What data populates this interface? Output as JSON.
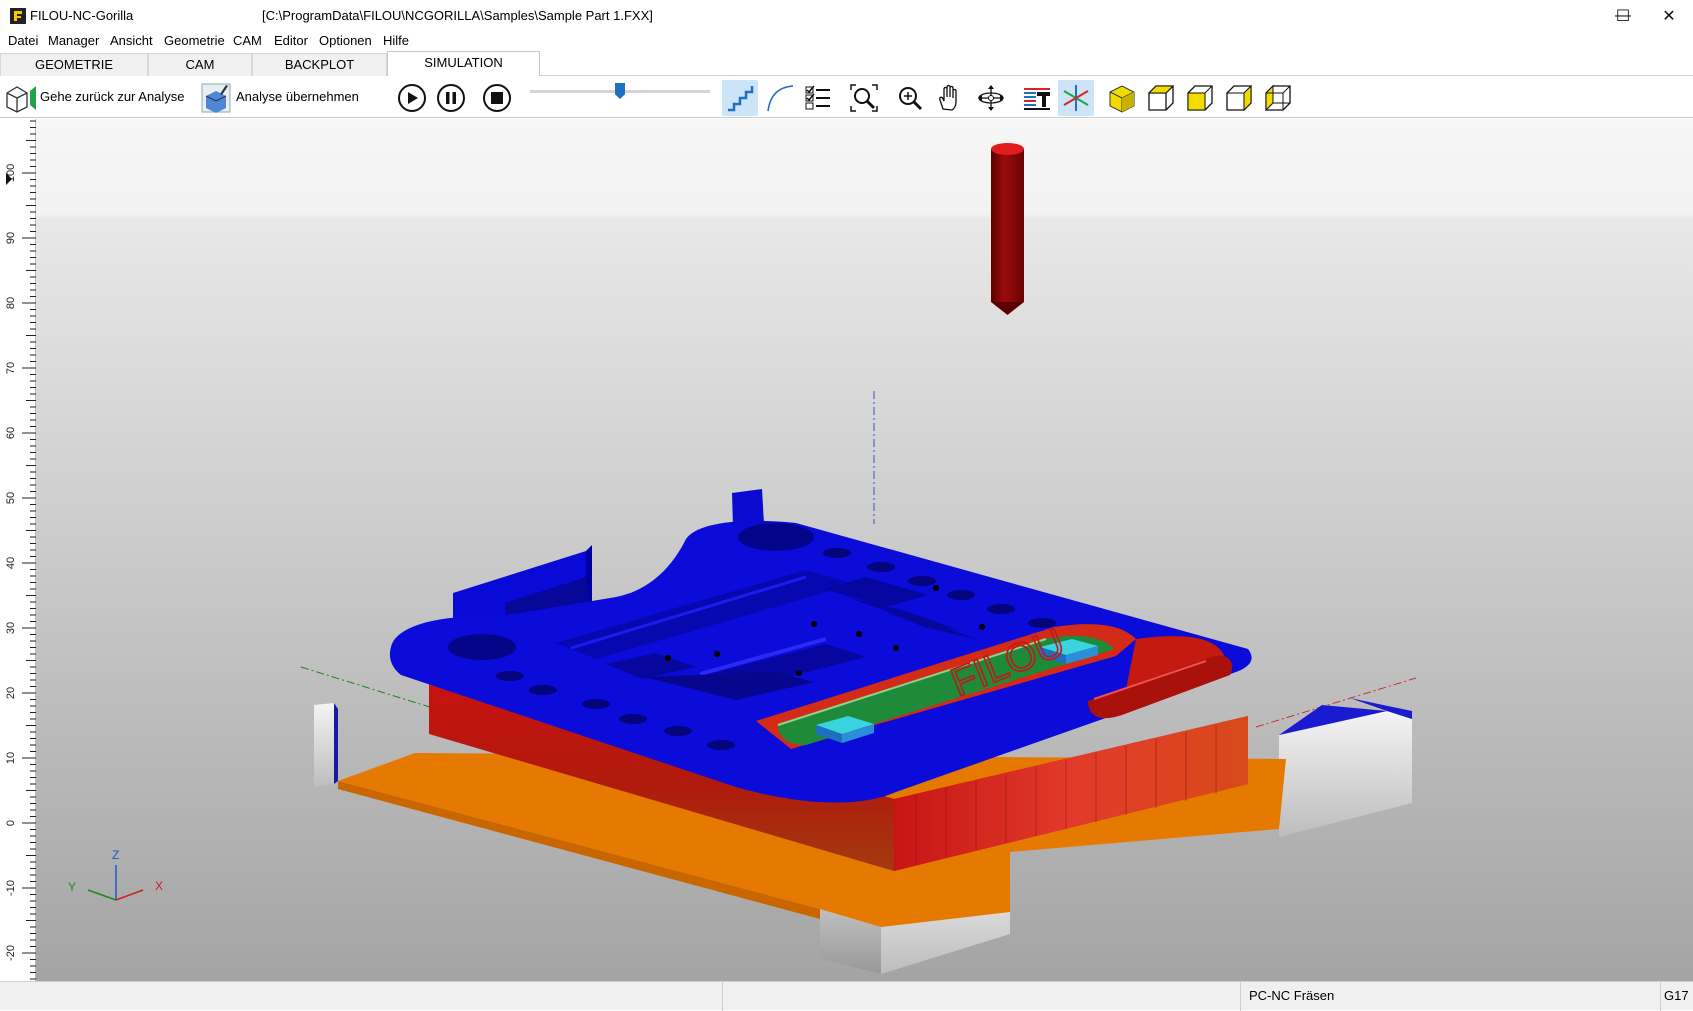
{
  "window": {
    "app_name": "FILOU-NC-Gorilla",
    "document_path": "[C:\\ProgramData\\FILOU\\NCGORILLA\\Samples\\Sample Part 1.FXX]",
    "minimize": "—",
    "maximize": "☐",
    "close": "✕"
  },
  "menu": [
    "Datei",
    "Manager",
    "Ansicht",
    "Geometrie",
    "CAM",
    "Editor",
    "Optionen",
    "Hilfe"
  ],
  "tabs": [
    {
      "label": "GEOMETRIE",
      "active": false
    },
    {
      "label": "CAM",
      "active": false
    },
    {
      "label": "BACKPLOT",
      "active": false
    },
    {
      "label": "SIMULATION",
      "active": true
    }
  ],
  "toolbar": {
    "back_label": "Gehe zurück zur Analyse",
    "apply_label": "Analyse übernehmen",
    "speed_fraction": 0.5
  },
  "ruler": {
    "labels": [
      "100",
      "90",
      "80",
      "70",
      "60",
      "50",
      "40",
      "30",
      "20",
      "10",
      "0",
      "-10",
      "-20"
    ]
  },
  "axes": {
    "z": "Z",
    "y": "Y",
    "x": "X"
  },
  "part_engraving": "FILOU",
  "statusbar": {
    "machine": "PC-NC Fräsen",
    "gcode_plane": "G17"
  },
  "colors": {
    "stock_blue": "#0a0ad8",
    "wall_red": "#c41010",
    "base_orange": "#e67a00",
    "pocket_green": "#1f8a3a",
    "tool_red": "#8b0a0a",
    "toolbar_selected": "#cce4f7"
  }
}
